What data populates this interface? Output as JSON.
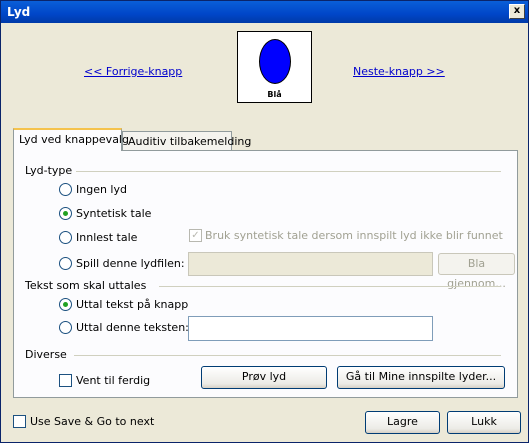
{
  "window": {
    "title": "Lyd",
    "close_glyph": "x"
  },
  "nav": {
    "prev_label": "<< Forrige-knapp",
    "next_label": "Neste-knapp >>",
    "preview_caption": "Blå",
    "preview_color": "#0000ff"
  },
  "tabs": [
    {
      "label": "Lyd ved knappevalg",
      "active": true
    },
    {
      "label": "Auditiv tilbakemelding",
      "active": false
    }
  ],
  "sound_type": {
    "heading": "Lyd-type",
    "options": [
      {
        "label": "Ingen lyd",
        "checked": false
      },
      {
        "label": "Syntetisk tale",
        "checked": true
      },
      {
        "label": "Innlest tale",
        "checked": false
      },
      {
        "label": "Spill denne lydfilen:",
        "checked": false
      }
    ],
    "fallback_checkbox_label": "Bruk syntetisk tale dersom innspilt lyd ikke blir funnet",
    "fallback_checked": true,
    "file_value": "",
    "browse_label": "Bla gjennom..."
  },
  "speak_text": {
    "heading": "Tekst som skal uttales",
    "options": [
      {
        "label": "Uttal tekst på knapp",
        "checked": true
      },
      {
        "label": "Uttal denne teksten:",
        "checked": false
      }
    ],
    "text_value": ""
  },
  "misc": {
    "heading": "Diverse",
    "wait_label": "Vent til ferdig",
    "wait_checked": false,
    "try_sound_label": "Prøv lyd",
    "goto_recorded_label": "Gå til Mine innspilte lyder..."
  },
  "footer": {
    "save_next_label": "Use Save & Go to next",
    "save_label": "Lagre",
    "close_label": "Lukk"
  }
}
